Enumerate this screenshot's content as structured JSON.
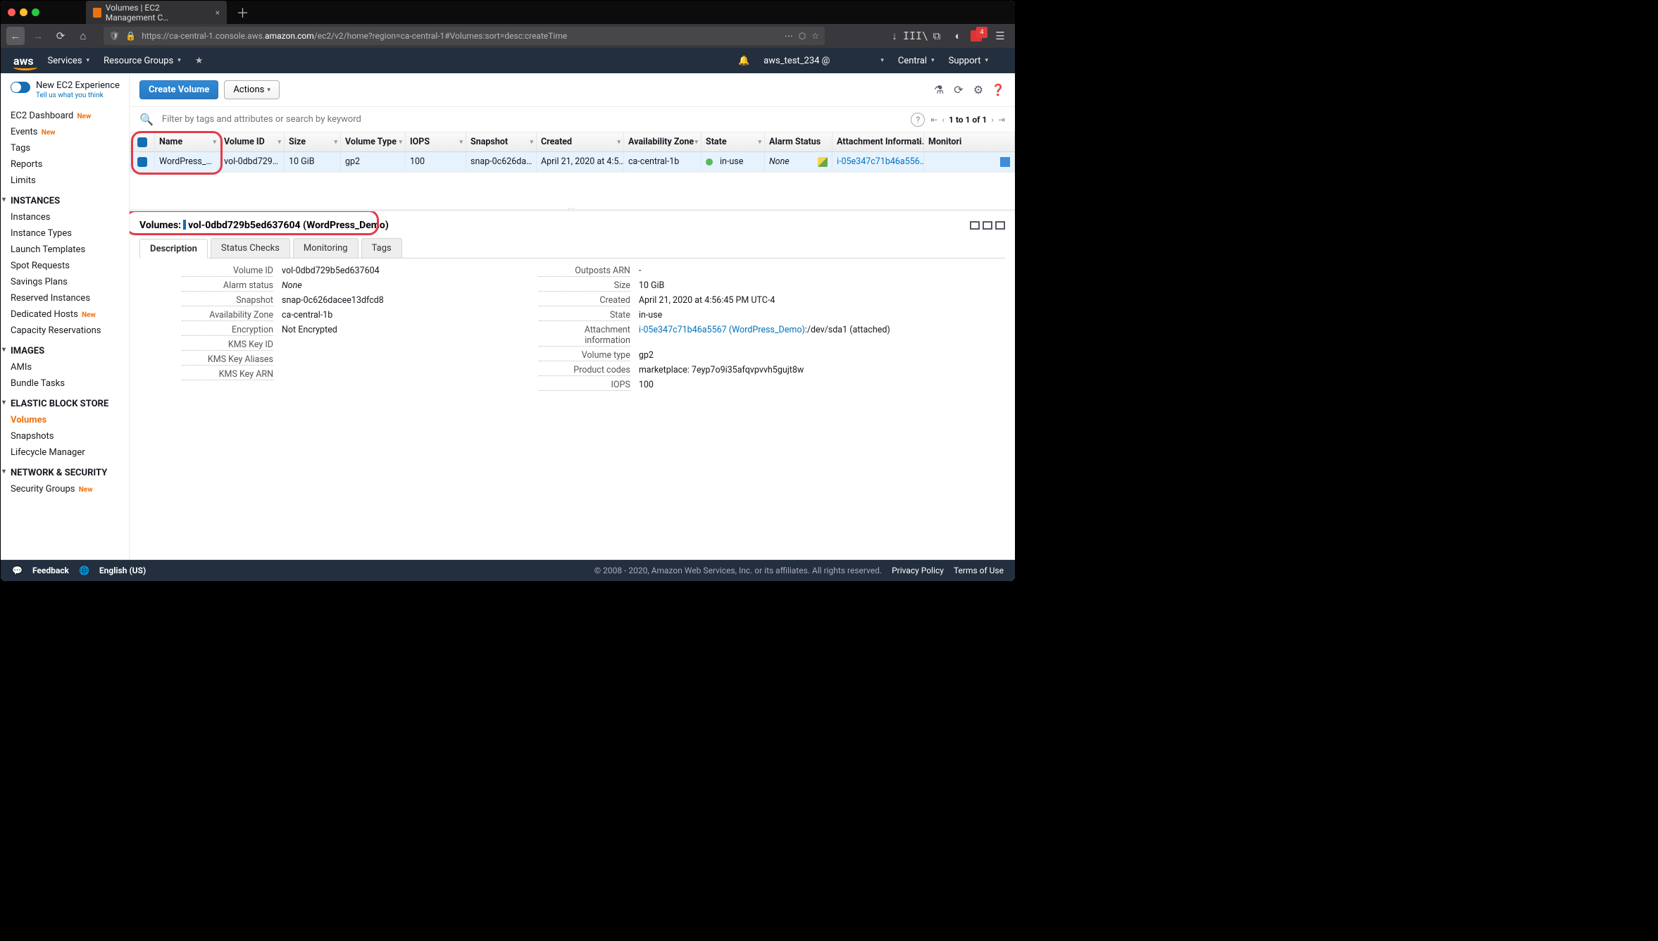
{
  "browser": {
    "tab_title": "Volumes | EC2 Management C…",
    "url_pre": "https://ca-central-1.console.aws.",
    "url_domain": "amazon.com",
    "url_post": "/ec2/v2/home?region=ca-central-1#Volumes:sort=desc:createTime",
    "ext_badge": "4"
  },
  "aws_nav": {
    "services": "Services",
    "resource_groups": "Resource Groups",
    "account": "aws_test_234 @",
    "region": "Central",
    "support": "Support"
  },
  "new_experience": {
    "title": "New EC2 Experience",
    "subtitle": "Tell us what you think"
  },
  "sidebar": {
    "dashboard": "EC2 Dashboard",
    "events": "Events",
    "tags": "Tags",
    "reports": "Reports",
    "limits": "Limits",
    "h_inst": "INSTANCES",
    "instances": "Instances",
    "inst_types": "Instance Types",
    "launch_tpl": "Launch Templates",
    "spot": "Spot Requests",
    "savings": "Savings Plans",
    "reserved": "Reserved Instances",
    "dedicated": "Dedicated Hosts",
    "capacity": "Capacity Reservations",
    "h_img": "IMAGES",
    "amis": "AMIs",
    "bundle": "Bundle Tasks",
    "h_ebs": "ELASTIC BLOCK STORE",
    "volumes": "Volumes",
    "snapshots": "Snapshots",
    "lifecycle": "Lifecycle Manager",
    "h_net": "NETWORK & SECURITY",
    "secgroups": "Security Groups",
    "new_badge": "New"
  },
  "toolbar": {
    "create": "Create Volume",
    "actions": "Actions"
  },
  "filter": {
    "placeholder": "Filter by tags and attributes or search by keyword",
    "pager": "1 to 1 of 1"
  },
  "columns": {
    "name": "Name",
    "vid": "Volume ID",
    "size": "Size",
    "vtype": "Volume Type",
    "iops": "IOPS",
    "snap": "Snapshot",
    "created": "Created",
    "az": "Availability Zone",
    "state": "State",
    "alarm": "Alarm Status",
    "att": "Attachment Informati…",
    "mon": "Monitori"
  },
  "row": {
    "name": "WordPress_…",
    "vid": "vol-0dbd729…",
    "size": "10 GiB",
    "vtype": "gp2",
    "iops": "100",
    "snap": "snap-0c626da…",
    "created": "April 21, 2020 at 4:5…",
    "az": "ca-central-1b",
    "state": "in-use",
    "alarm": "None",
    "att": "i-05e347c71b46a556…"
  },
  "details": {
    "heading_prefix": "Volumes:",
    "heading_value": "vol-0dbd729b5ed637604 (WordPress_Demo)",
    "tabs": {
      "desc": "Description",
      "status": "Status Checks",
      "mon": "Monitoring",
      "tags": "Tags"
    },
    "left": {
      "vid_k": "Volume ID",
      "vid_v": "vol-0dbd729b5ed637604",
      "alarm_k": "Alarm status",
      "alarm_v": "None",
      "snap_k": "Snapshot",
      "snap_v": "snap-0c626dacee13dfcd8",
      "az_k": "Availability Zone",
      "az_v": "ca-central-1b",
      "enc_k": "Encryption",
      "enc_v": "Not Encrypted",
      "kms_k": "KMS Key ID",
      "kms_v": "",
      "kmsa_k": "KMS Key Aliases",
      "kmsa_v": "",
      "kmsarn_k": "KMS Key ARN",
      "kmsarn_v": ""
    },
    "right": {
      "arn_k": "Outposts ARN",
      "arn_v": "-",
      "size_k": "Size",
      "size_v": "10 GiB",
      "crt_k": "Created",
      "crt_v": "April 21, 2020 at 4:56:45 PM UTC-4",
      "state_k": "State",
      "state_v": "in-use",
      "ai_k": "Attachment information",
      "ai_link": "i-05e347c71b46a5567 (WordPress_Demo)",
      "ai_tail": ":/dev/sda1 (attached)",
      "vt_k": "Volume type",
      "vt_v": "gp2",
      "pc_k": "Product codes",
      "pc_v": "marketplace: 7eyp7o9i35afqvpvvh5gujt8w",
      "iops_k": "IOPS",
      "iops_v": "100"
    }
  },
  "footer": {
    "feedback": "Feedback",
    "lang": "English (US)",
    "copy": "© 2008 - 2020, Amazon Web Services, Inc. or its affiliates. All rights reserved.",
    "privacy": "Privacy Policy",
    "terms": "Terms of Use"
  }
}
